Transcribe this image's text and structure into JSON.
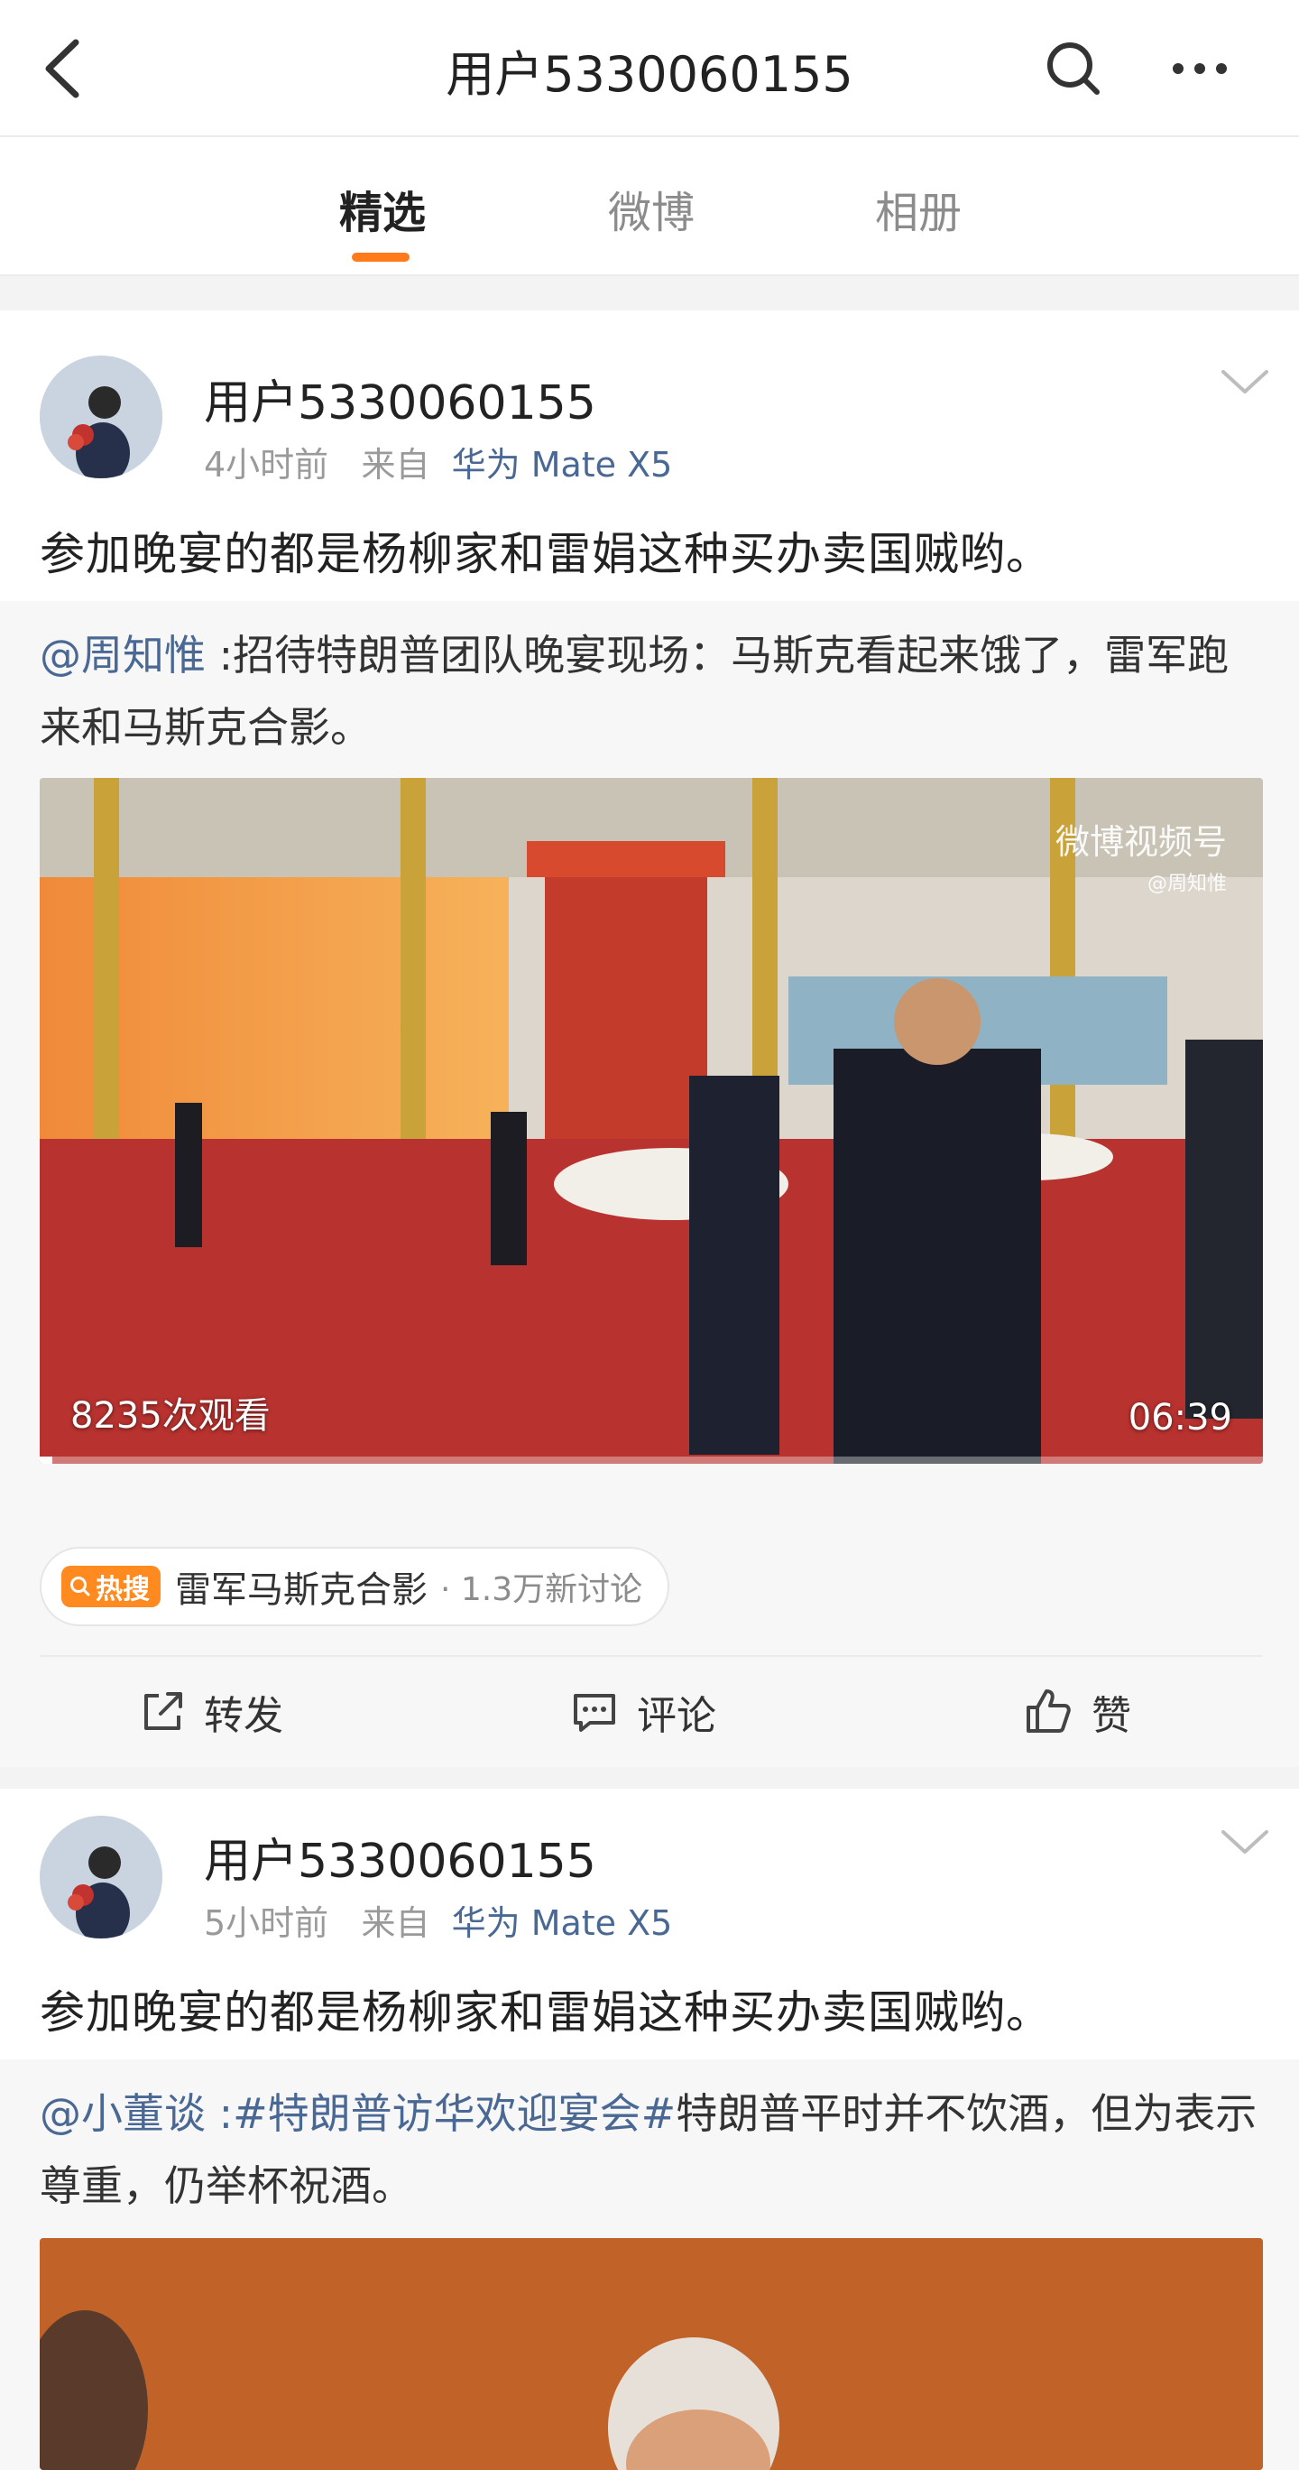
{
  "header": {
    "title": "用户5330060155",
    "back_icon": "chevron-left-icon",
    "search_icon": "search-icon",
    "more_icon": "more-dots-icon"
  },
  "tabs": [
    {
      "label": "精选",
      "active": true
    },
    {
      "label": "微博",
      "active": false
    },
    {
      "label": "相册",
      "active": false
    }
  ],
  "accent_color": "#ff7a1a",
  "link_color": "#4a6894",
  "posts": [
    {
      "username": "用户5330060155",
      "time": "4小时前",
      "from_label": "来自",
      "device": "华为 Mate X5",
      "text": "参加晚宴的都是杨柳家和雷娟这种买办卖国贼哟。",
      "repost": {
        "mention": "@周知惟",
        "text": " :招待特朗普团队晚宴现场：马斯克看起来饿了，雷军跑来和马斯克合影。"
      },
      "video": {
        "views": "8235次观看",
        "duration": "06:39",
        "watermark": "微博视频号",
        "watermark_author": "@周知惟"
      },
      "hot": {
        "badge": "热搜",
        "topic": "雷军马斯克合影",
        "count": "· 1.3万新讨论"
      },
      "actions": {
        "repost": "转发",
        "comment": "评论",
        "like": "赞"
      }
    },
    {
      "username": "用户5330060155",
      "time": "5小时前",
      "from_label": "来自",
      "device": "华为 Mate X5",
      "text": "参加晚宴的都是杨柳家和雷娟这种买办卖国贼哟。",
      "repost": {
        "mention": "@小董谈",
        "hashtag": " :#特朗普访华欢迎宴会#",
        "text": "特朗普平时并不饮酒，但为表示尊重，仍举杯祝酒。"
      }
    }
  ]
}
